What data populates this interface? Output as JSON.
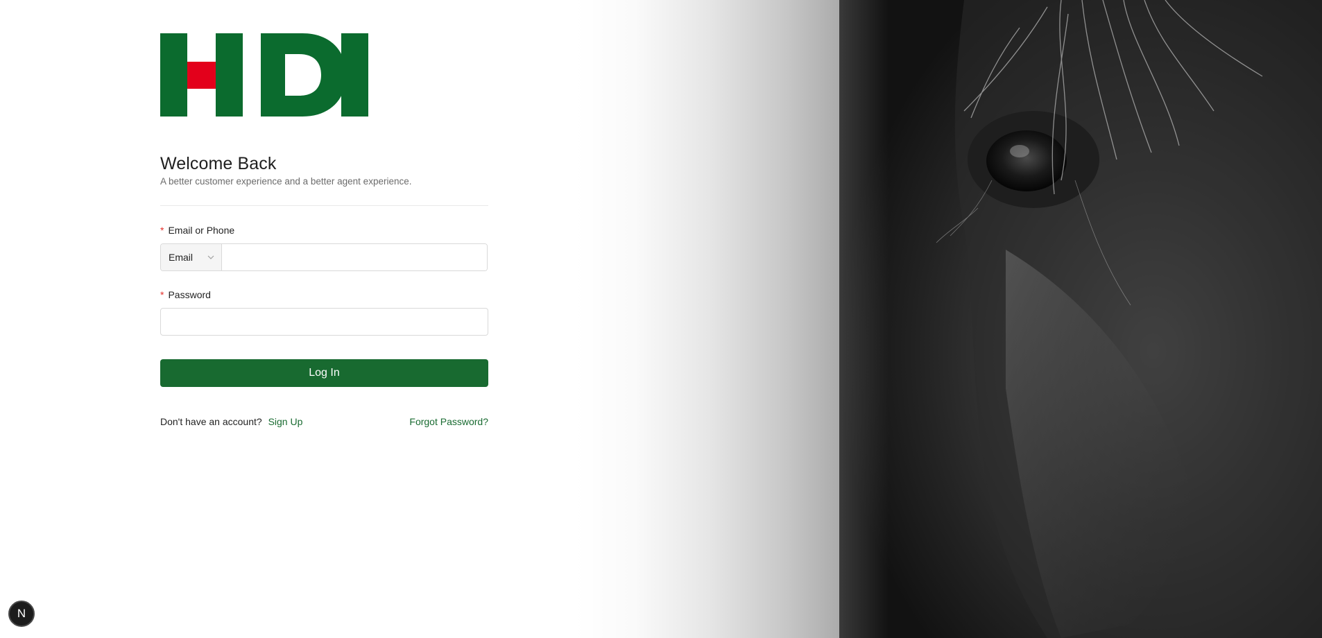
{
  "brand": {
    "logo_text": "HDI",
    "green": "#0b6b2e",
    "red": "#e3001b"
  },
  "welcome": {
    "title": "Welcome Back",
    "subtitle": "A better customer experience and a better agent experience."
  },
  "form": {
    "email_label": "Email or Phone",
    "email_type_selected": "Email",
    "email_value": "",
    "password_label": "Password",
    "password_value": "",
    "required_mark": "*",
    "submit_label": "Log In"
  },
  "footer": {
    "no_account_text": "Don't have an account?",
    "signup_label": "Sign Up",
    "forgot_label": "Forgot Password?"
  },
  "dev_badge": {
    "letter": "N"
  },
  "colors": {
    "primary": "#186a30",
    "required": "#e4312b"
  },
  "hero": {
    "icon": "horse-photo"
  }
}
